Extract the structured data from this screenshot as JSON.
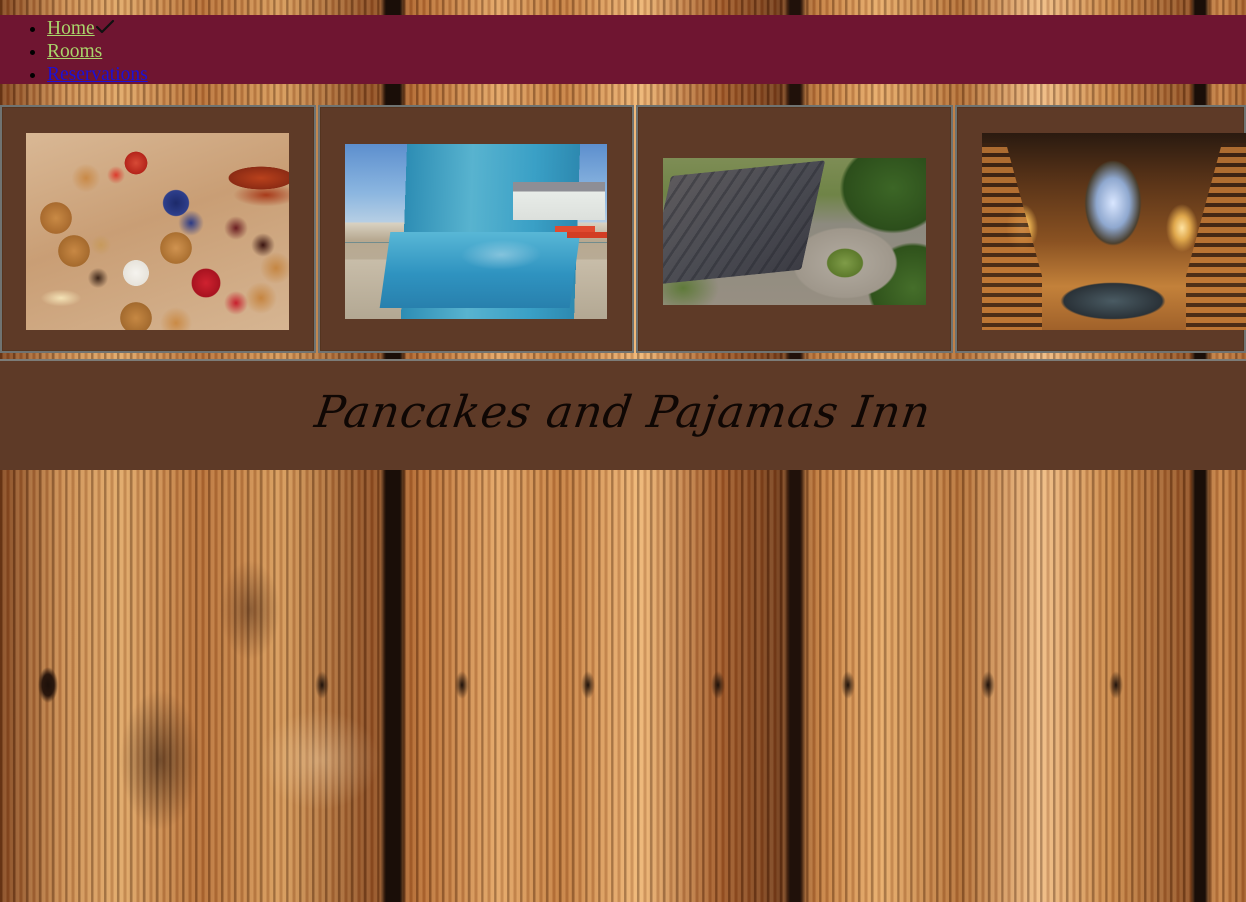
{
  "nav": {
    "items": [
      {
        "label": "Home",
        "color": "#a9d46b",
        "current": true
      },
      {
        "label": "Rooms",
        "color": "#a9d46b"
      },
      {
        "label": "Reservations",
        "color": "#1a10d8"
      }
    ],
    "current_indicator_icon": "checkmark-icon",
    "background": "#6f1531"
  },
  "gallery": {
    "photos": [
      {
        "subject": "pancake breakfast board"
      },
      {
        "subject": "outdoor swimming pool"
      },
      {
        "subject": "aerial view of inn with fountain"
      },
      {
        "subject": "grand staircase entrance hall"
      }
    ],
    "panel_color": "#5e3a27"
  },
  "banner": {
    "title": "Pancakes and Pajamas Inn",
    "background": "#5e3a27"
  },
  "page": {
    "background_texture": "weathered wood planks"
  }
}
